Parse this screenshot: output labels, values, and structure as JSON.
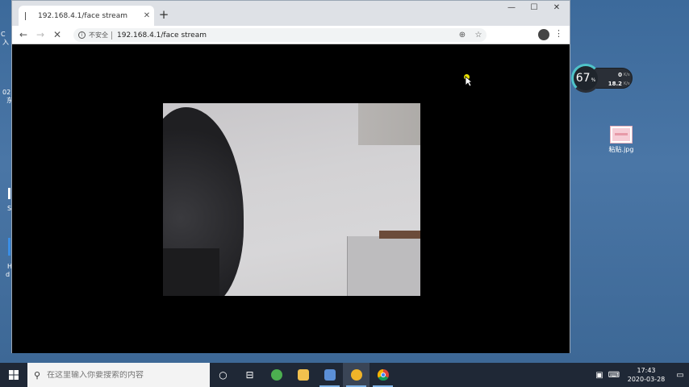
{
  "browser": {
    "tab_title": "192.168.4.1/face stream",
    "new_tab": "+",
    "security_label": "不安全",
    "url": "192.168.4.1/face stream"
  },
  "desktop": {
    "file_label": "粘贴.jpg",
    "partial_labels": [
      "C",
      "入",
      "02",
      "东",
      "S",
      "H",
      "d"
    ]
  },
  "net_monitor": {
    "percent": "67",
    "percent_unit": "%",
    "upload_value": "0",
    "upload_unit": "K/s",
    "download_value": "18.2",
    "download_unit": "K/s"
  },
  "taskbar": {
    "search_placeholder": "在这里输入你要搜索的内容",
    "time": "17:43",
    "date": "2020-03-28"
  },
  "colors": {
    "desktop": "#4a76a6",
    "taskbar": "#1f2836",
    "accent_ring": "#4fc3c8"
  }
}
